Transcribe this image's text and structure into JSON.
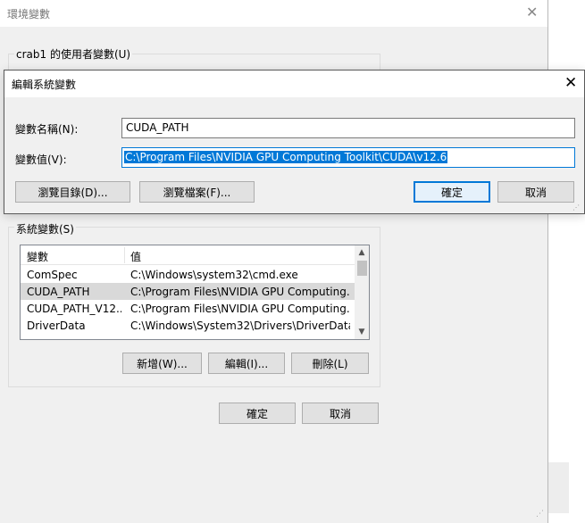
{
  "env_dialog": {
    "title": "環境變數",
    "user_group_label": "crab1 的使用者變數(U)",
    "system_group_label": "系統變數(S)",
    "columns": [
      "變數",
      "值"
    ],
    "rows": [
      {
        "name": "ComSpec",
        "value": "C:\\Windows\\system32\\cmd.exe",
        "selected": false
      },
      {
        "name": "CUDA_PATH",
        "value": "C:\\Program Files\\NVIDIA GPU Computing...",
        "selected": true
      },
      {
        "name": "CUDA_PATH_V12...",
        "value": "C:\\Program Files\\NVIDIA GPU Computing...",
        "selected": false
      },
      {
        "name": "DriverData",
        "value": "C:\\Windows\\System32\\Drivers\\DriverData",
        "selected": false
      }
    ],
    "buttons": {
      "new": "新增(W)...",
      "edit": "編輯(I)...",
      "delete": "刪除(L)",
      "ok": "確定",
      "cancel": "取消"
    }
  },
  "edit_dialog": {
    "title": "編輯系統變數",
    "name_label": "變數名稱(N):",
    "name_value": "CUDA_PATH",
    "value_label": "變數值(V):",
    "value_value": "C:\\Program Files\\NVIDIA GPU Computing Toolkit\\CUDA\\v12.6",
    "buttons": {
      "browse_dir": "瀏覽目錄(D)...",
      "browse_file": "瀏覽檔案(F)...",
      "ok": "確定",
      "cancel": "取消"
    }
  },
  "icons": {
    "close": "✕",
    "scroll_up": "▲",
    "scroll_down": "▼",
    "resize_grip": "⋰"
  },
  "colors": {
    "accent": "#0078d7",
    "dialog_bg": "#f0f0f0",
    "selected_row": "#d9d9d9"
  }
}
